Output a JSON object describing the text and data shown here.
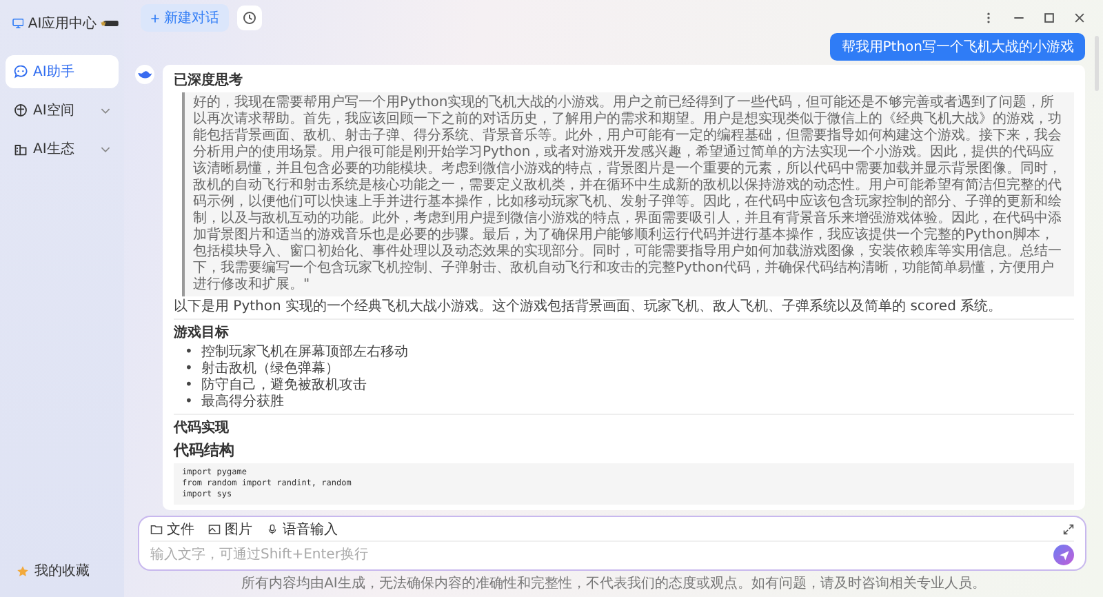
{
  "app": {
    "name": "AI应用中心"
  },
  "sidebar": {
    "items": [
      {
        "label": "AI助手",
        "selected": true,
        "expandable": false
      },
      {
        "label": "AI空间",
        "selected": false,
        "expandable": true
      },
      {
        "label": "AI生态",
        "selected": false,
        "expandable": true
      }
    ],
    "favorites": "我的收藏"
  },
  "toolbar": {
    "new_chat": "新建对话"
  },
  "conversation": {
    "user_message": "帮我用Pthon写一个飞机大战的小游戏",
    "reply": {
      "thinking_title": "已深度思考",
      "thinking": "好的，我现在需要帮用户写一个用Python实现的飞机大战的小游戏。用户之前已经得到了一些代码，但可能还是不够完善或者遇到了问题，所以再次请求帮助。首先，我应该回顾一下之前的对话历史，了解用户的需求和期望。用户是想实现类似于微信上的《经典飞机大战》的游戏，功能包括背景画面、敌机、射击子弹、得分系统、背景音乐等。此外，用户可能有一定的编程基础，但需要指导如何构建这个游戏。接下来，我会分析用户的使用场景。用户很可能是刚开始学习Python，或者对游戏开发感兴趣，希望通过简单的方法实现一个小游戏。因此，提供的代码应该清晰易懂，并且包含必要的功能模块。考虑到微信小游戏的特点，背景图片是一个重要的元素，所以代码中需要加载并显示背景图像。同时，敌机的自动飞行和射击系统是核心功能之一，需要定义敌机类，并在循环中生成新的敌机以保持游戏的动态性。用户可能希望有简洁但完整的代码示例，以便他们可以快速上手并进行基本操作，比如移动玩家飞机、发射子弹等。因此，在代码中应该包含玩家控制的部分、子弹的更新和绘制，以及与敌机互动的功能。此外，考虑到用户提到微信小游戏的特点，界面需要吸引人，并且有背景音乐来增强游戏体验。因此，在代码中添加背景图片和适当的游戏音乐也是必要的步骤。最后，为了确保用户能够顺利运行代码并进行基本操作，我应该提供一个完整的Python脚本，包括模块导入、窗口初始化、事件处理以及动态效果的实现部分。同时，可能需要指导用户如何加载游戏图像，安装依赖库等实用信息。总结一下，我需要编写一个包含玩家飞机控制、子弹射击、敌机自动飞行和攻击的完整Python代码，并确保代码结构清晰，功能简单易懂，方便用户进行修改和扩展。\"",
      "summary": "以下是用 Python 实现的一个经典飞机大战小游戏。这个游戏包括背景画面、玩家飞机、敌人飞机、子弹系统以及简单的 scored 系统。",
      "sections": [
        {
          "kind": "divider"
        },
        {
          "kind": "heading",
          "text": "游戏目标"
        },
        {
          "kind": "bullets",
          "marker": "•",
          "items": [
            "控制玩家飞机在屏幕顶部左右移动",
            "射击敌机（绿色弹幕）",
            "防守自己，避免被敌机攻击",
            "最高得分获胜"
          ]
        },
        {
          "kind": "divider"
        },
        {
          "kind": "heading",
          "text": "代码实现"
        },
        {
          "kind": "title",
          "text": "代码结构"
        },
        {
          "kind": "code",
          "lines": [
            "import pygame",
            "from random import randint, random",
            "import sys"
          ]
        }
      ]
    }
  },
  "composer": {
    "tools": [
      {
        "label": "文件"
      },
      {
        "label": "图片"
      },
      {
        "label": "语音输入"
      }
    ],
    "placeholder": "输入文字，可通过Shift+Enter换行"
  },
  "disclaimer": "所有内容均由AI生成，无法确保内容的准确性和完整性，不代表我们的态度或观点。如有问题，请及时咨询相关专业人员。"
}
